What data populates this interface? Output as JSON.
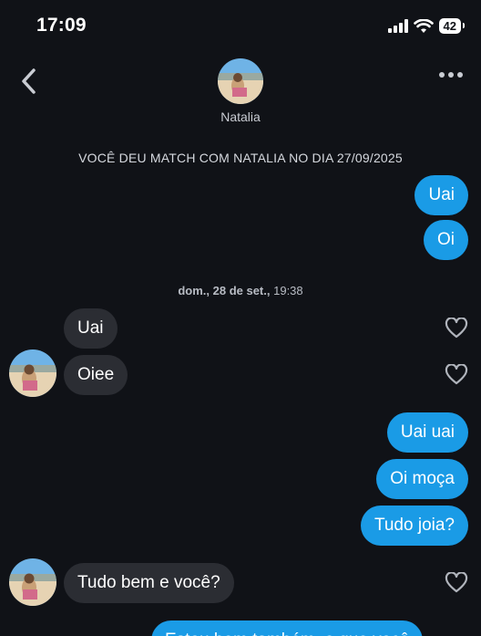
{
  "status": {
    "time": "17:09",
    "battery": "42"
  },
  "header": {
    "name": "Natalia"
  },
  "match_banner": "VOCÊ DEU MATCH COM NATALIA NO DIA 27/09/2025",
  "timestamp": {
    "day": "dom., 28 de set.,",
    "time": " 19:38"
  },
  "messages": [
    {
      "text": "Uai",
      "direction": "out"
    },
    {
      "text": "Oi",
      "direction": "out"
    },
    {
      "text": "Uai",
      "direction": "in"
    },
    {
      "text": "Oiee",
      "direction": "in"
    },
    {
      "text": "Uai uai",
      "direction": "out"
    },
    {
      "text": "Oi moça",
      "direction": "out"
    },
    {
      "text": "Tudo joia?",
      "direction": "out"
    },
    {
      "text": "Tudo bem e você?",
      "direction": "in"
    },
    {
      "text": "Estou bem também, o que você",
      "direction": "out"
    }
  ],
  "colors": {
    "background": "#101217",
    "outgoing": "#1a9be6",
    "incoming": "#2b2d33"
  },
  "icons": [
    "back-chevron-icon",
    "more-dots-icon",
    "heart-icon",
    "wifi-icon",
    "signal-icon",
    "battery-icon"
  ]
}
